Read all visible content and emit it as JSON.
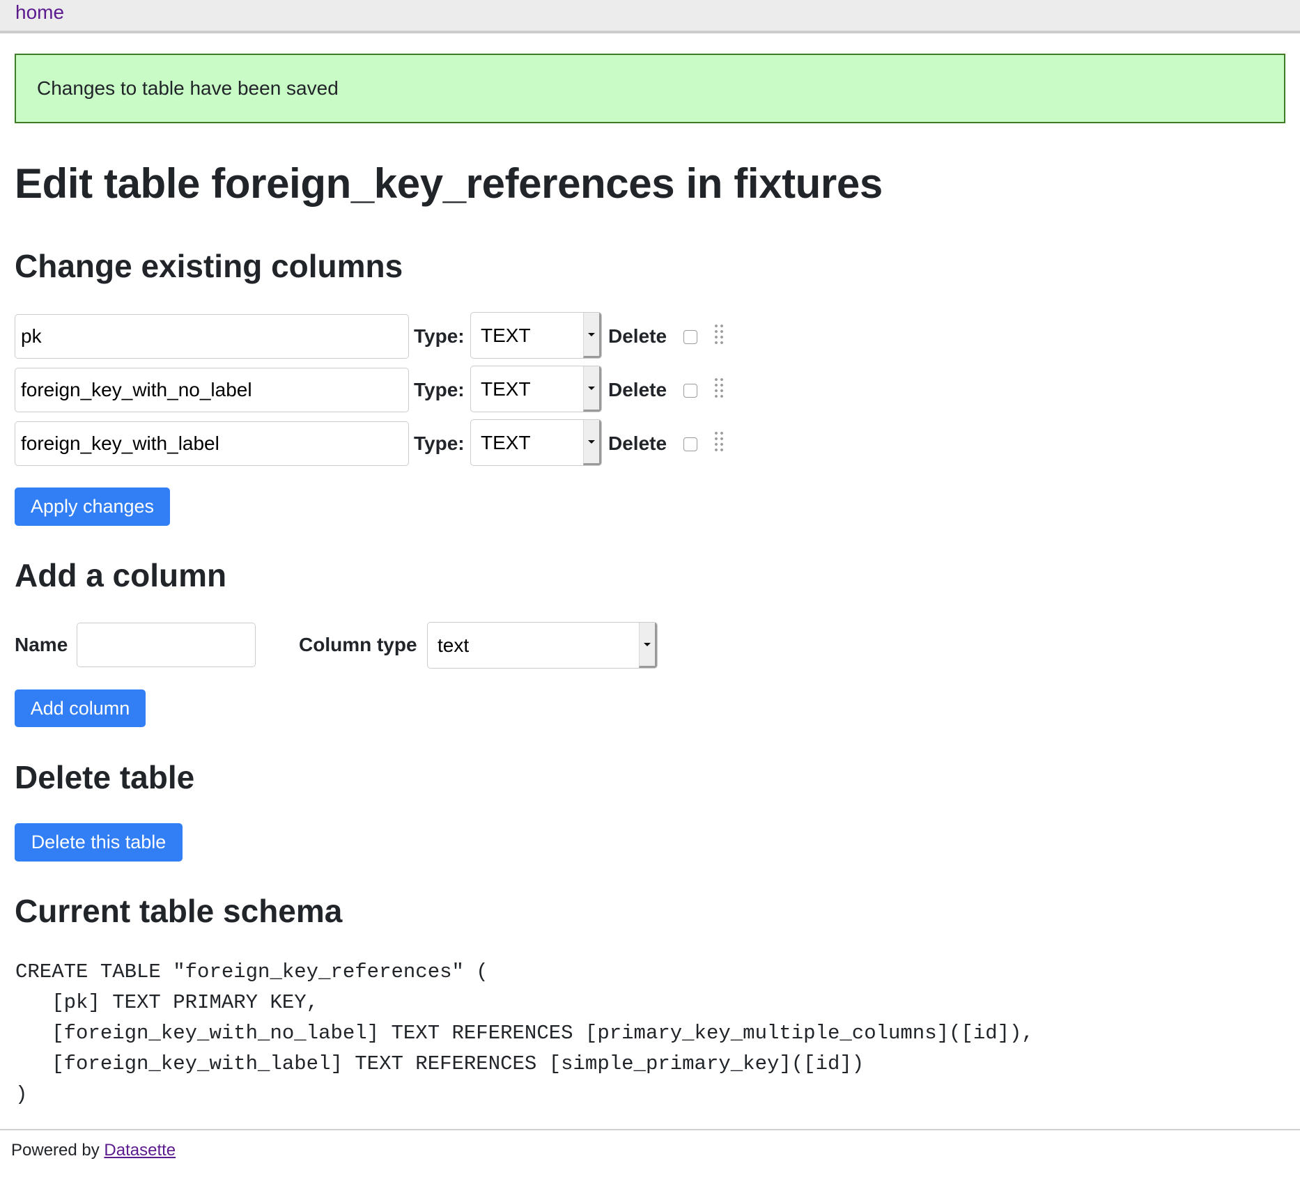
{
  "nav": {
    "home_label": "home"
  },
  "message": {
    "text": "Changes to table have been saved",
    "bg_color": "#c8fbc6",
    "border_color": "#3e7d25"
  },
  "page": {
    "title": "Edit table foreign_key_references in fixtures"
  },
  "change_columns": {
    "heading": "Change existing columns",
    "type_label": "Type:",
    "delete_label": "Delete",
    "rows": [
      {
        "name": "pk",
        "type": "TEXT",
        "delete_checked": false
      },
      {
        "name": "foreign_key_with_no_label",
        "type": "TEXT",
        "delete_checked": false
      },
      {
        "name": "foreign_key_with_label",
        "type": "TEXT",
        "delete_checked": false
      }
    ],
    "apply_button": "Apply changes"
  },
  "add_column": {
    "heading": "Add a column",
    "name_label": "Name",
    "name_value": "",
    "type_label": "Column type",
    "type_value": "text",
    "button": "Add column"
  },
  "delete_table": {
    "heading": "Delete table",
    "button": "Delete this table"
  },
  "schema": {
    "heading": "Current table schema",
    "sql": "CREATE TABLE \"foreign_key_references\" (\n   [pk] TEXT PRIMARY KEY,\n   [foreign_key_with_no_label] TEXT REFERENCES [primary_key_multiple_columns]([id]),\n   [foreign_key_with_label] TEXT REFERENCES [simple_primary_key]([id])\n)"
  },
  "footer": {
    "prefix": "Powered by ",
    "link_label": "Datasette"
  },
  "colors": {
    "accent": "#317ef5",
    "link": "#5b1a8e",
    "header_bg": "#ececec"
  }
}
